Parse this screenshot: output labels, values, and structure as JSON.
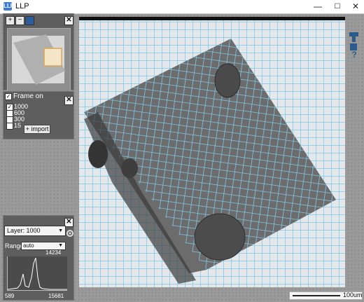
{
  "window": {
    "title": "LLP",
    "app_icon": "llp-icon"
  },
  "controls": {
    "minimize": "—",
    "maximize": "☐",
    "close": "✕"
  },
  "overview_panel": {
    "zoom_in": "+",
    "zoom_out": "−",
    "close": "✕"
  },
  "frame_panel": {
    "frame_on_label": "Frame on",
    "frame_on_checked": true,
    "frames": [
      {
        "label": "1000",
        "checked": true
      },
      {
        "label": "600",
        "checked": false
      },
      {
        "label": "300",
        "checked": false
      },
      {
        "label": "15",
        "checked": false
      }
    ],
    "import_label": "+ import",
    "close": "✕"
  },
  "layer_panel": {
    "layer_value": "Layer: 1000",
    "range_label": "Range",
    "range_value": "auto",
    "hist_max": "14234",
    "hist_min_x": "589",
    "hist_max_x": "15681",
    "close": "✕"
  },
  "scale": {
    "label": "100um"
  },
  "tools": {
    "top": "rect-tool-icon",
    "mid": "document-icon",
    "help": "?"
  }
}
